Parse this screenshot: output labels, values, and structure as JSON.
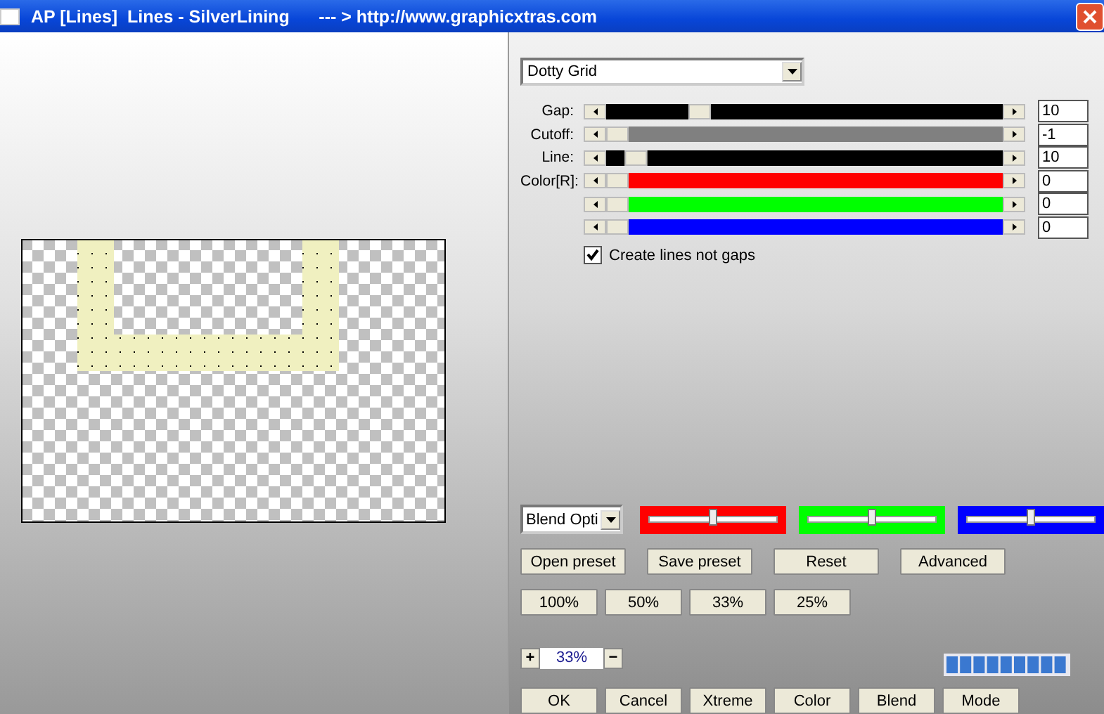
{
  "window": {
    "title": "AP [Lines]  Lines - SilverLining      --- > http://www.graphicxtras.com"
  },
  "preset_dropdown": {
    "value": "Dotty Grid"
  },
  "sliders": [
    {
      "label": "Gap:",
      "level": 0.22,
      "color": "#000000",
      "value": "10"
    },
    {
      "label": "Cutoff:",
      "level": 0,
      "color": "#808080",
      "value": "-1"
    },
    {
      "label": "Line:",
      "level": 0.05,
      "color": "#000000",
      "value": "10"
    },
    {
      "label": "Color[R]:",
      "level": 0,
      "color": "#ff0000",
      "value": "0"
    },
    {
      "level": 0,
      "color": "#00ff00",
      "value": "0"
    },
    {
      "level": 0,
      "color": "#0000ff",
      "value": "0"
    }
  ],
  "checkbox": {
    "label": "Create lines not gaps",
    "checked": true
  },
  "blend_dropdown": {
    "value": "Blend Opti"
  },
  "blend_sliders": [
    {
      "level": 0.5,
      "color": "#ff0000"
    },
    {
      "level": 0.5,
      "color": "#00ff00"
    },
    {
      "level": 0.5,
      "color": "#0000ff"
    }
  ],
  "preset_buttons": [
    "Open preset",
    "Save preset",
    "Reset",
    "Advanced"
  ],
  "zoom_buttons": [
    "100%",
    "50%",
    "33%",
    "25%"
  ],
  "zoom": {
    "plus": "+",
    "value": "33%",
    "minus": "−"
  },
  "action_buttons": [
    "OK",
    "Cancel",
    "Xtreme",
    "Color",
    "Blend",
    "Mode"
  ]
}
